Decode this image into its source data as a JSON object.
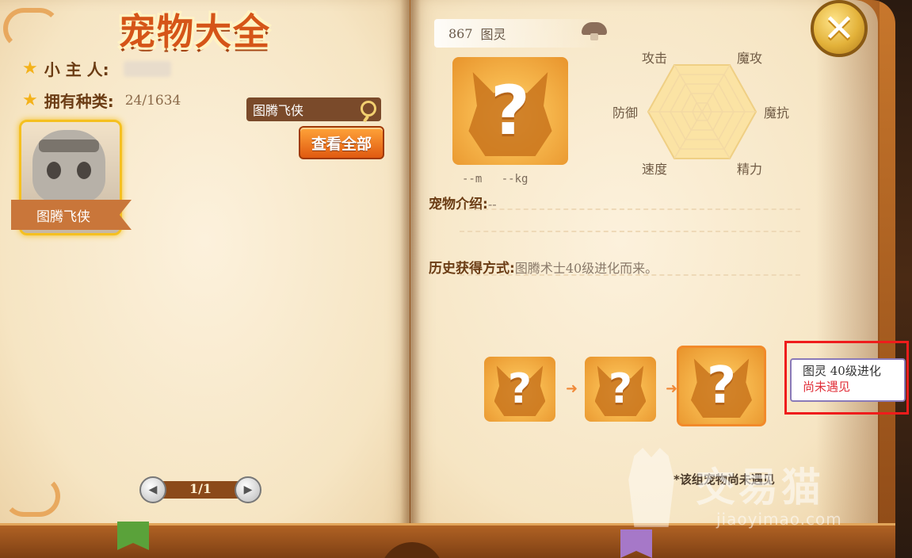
{
  "left_page": {
    "title": "宠物大全",
    "owner_label": "小 主 人:",
    "owner_value": "",
    "species_label": "拥有种类:",
    "species_value": "24/1634",
    "search": {
      "value": "图腾飞侠",
      "placeholder": ""
    },
    "view_all_label": "查看全部",
    "pet_card": {
      "name": "图腾飞侠"
    },
    "pagination": {
      "text": "1/1"
    }
  },
  "right_page": {
    "header": {
      "number": "867",
      "name": "图灵"
    },
    "unknown_mark": "?",
    "height": "--m",
    "weight": "--kg",
    "radar_labels": {
      "attack": "攻击",
      "magic_attack": "魔攻",
      "magic_resist": "魔抗",
      "energy": "精力",
      "speed": "速度",
      "defense": "防御"
    },
    "intro_label": "宠物介绍:",
    "intro_value": "--",
    "history_label": "历史获得方式:",
    "history_value": "图腾术士40级进化而来。",
    "evolution_arrow": "➜",
    "tooltip": {
      "line1": "图灵 40级进化",
      "line2": "尚未遇见"
    },
    "footnote": "*该组宠物尚未遇见"
  },
  "close_label": "✕",
  "watermark": {
    "text": "交易猫",
    "url": "jiaoyimao.com"
  },
  "colors": {
    "title_orange": "#d55518",
    "tooltip_red": "#e1303a",
    "highlight_border": "#ef1c1c"
  }
}
